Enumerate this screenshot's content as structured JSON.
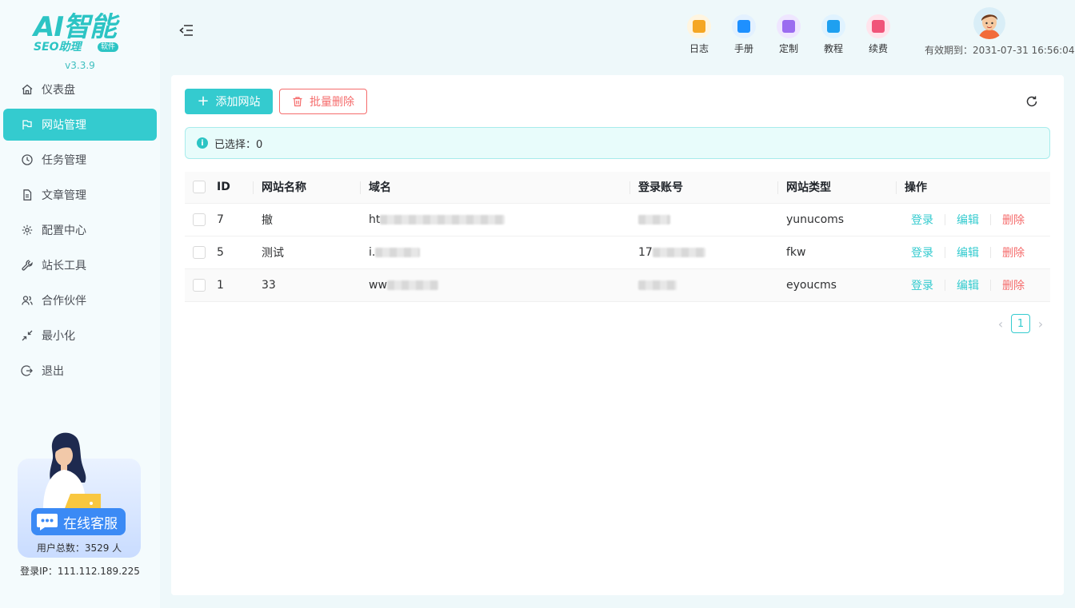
{
  "app": {
    "logo_big": "AI智能",
    "logo_small": "SEO助理",
    "logo_badge": "软件",
    "version": "v3.3.9"
  },
  "sidebar": {
    "items": [
      {
        "label": "仪表盘",
        "icon": "home-icon"
      },
      {
        "label": "网站管理",
        "icon": "flag-icon",
        "active": true
      },
      {
        "label": "任务管理",
        "icon": "clock-icon"
      },
      {
        "label": "文章管理",
        "icon": "document-icon"
      },
      {
        "label": "配置中心",
        "icon": "gear-icon"
      },
      {
        "label": "站长工具",
        "icon": "wrench-icon"
      },
      {
        "label": "合作伙伴",
        "icon": "users-icon"
      },
      {
        "label": "最小化",
        "icon": "shrink-icon"
      },
      {
        "label": "退出",
        "icon": "logout-icon"
      }
    ],
    "support": {
      "chat_label": "在线客服",
      "user_total": "用户总数：3529 人"
    },
    "login_ip": "登录IP：111.112.189.225"
  },
  "header": {
    "nav": [
      {
        "label": "日志",
        "color": "#f5a623",
        "bg": "#fff5e0"
      },
      {
        "label": "手册",
        "color": "#1e90ff",
        "bg": "#e3f1ff"
      },
      {
        "label": "定制",
        "color": "#9b6cf0",
        "bg": "#efe6ff"
      },
      {
        "label": "教程",
        "color": "#1ea0f0",
        "bg": "#e0f3ff"
      },
      {
        "label": "续费",
        "color": "#f0557a",
        "bg": "#ffe4ec"
      }
    ],
    "expire": "有效期到：2031-07-31 16:56:04"
  },
  "toolbar": {
    "add_label": "添加网站",
    "delete_label": "批量删除"
  },
  "alert": {
    "selected_text": "已选择：0"
  },
  "table": {
    "columns": [
      "ID",
      "网站名称",
      "域名",
      "登录账号",
      "网站类型",
      "操作"
    ],
    "rows": [
      {
        "id": "7",
        "name": "撤",
        "domain": "ht",
        "account": "",
        "type": "yunucoms"
      },
      {
        "id": "5",
        "name": "测试",
        "domain": "i.",
        "account": "17",
        "type": "fkw"
      },
      {
        "id": "1",
        "name": "33",
        "domain": "ww",
        "account": "",
        "type": "eyoucms"
      }
    ],
    "actions": {
      "login": "登录",
      "edit": "编辑",
      "delete": "删除"
    }
  },
  "pagination": {
    "current": "1",
    "prev": "‹",
    "next": "›"
  }
}
